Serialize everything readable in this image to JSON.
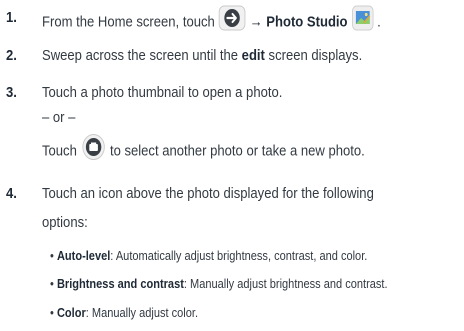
{
  "steps": [
    {
      "number": "1.",
      "parts": [
        "From the Home screen, touch",
        "→",
        "Photo Studio",
        "."
      ]
    },
    {
      "number": "2.",
      "parts": [
        "Sweep across the screen until the",
        "edit",
        "screen displays."
      ]
    },
    {
      "number": "3.",
      "line1": "Touch a photo thumbnail to open a photo.",
      "or": "– or –",
      "line3_before": "Touch",
      "line3_after": "to select another photo or take a new photo."
    },
    {
      "number": "4.",
      "line1": "Touch an icon above the photo displayed for the following",
      "line2": "options:",
      "bullets": [
        {
          "term": "Auto-level",
          "desc": ": Automatically adjust brightness, contrast, and color."
        },
        {
          "term": "Brightness and contrast",
          "desc": ": Manually adjust brightness and contrast."
        },
        {
          "term": "Color",
          "desc": ": Manually adjust color."
        }
      ]
    }
  ],
  "bullet_char": "•",
  "colors": {
    "text": "#333a42",
    "bold": "#1f2a36",
    "icon_dark": "#3a3f45",
    "photo_blue": "#4a90d6"
  },
  "icons": [
    "arrow-circle-icon",
    "photo-studio-icon",
    "camera-button-icon"
  ]
}
